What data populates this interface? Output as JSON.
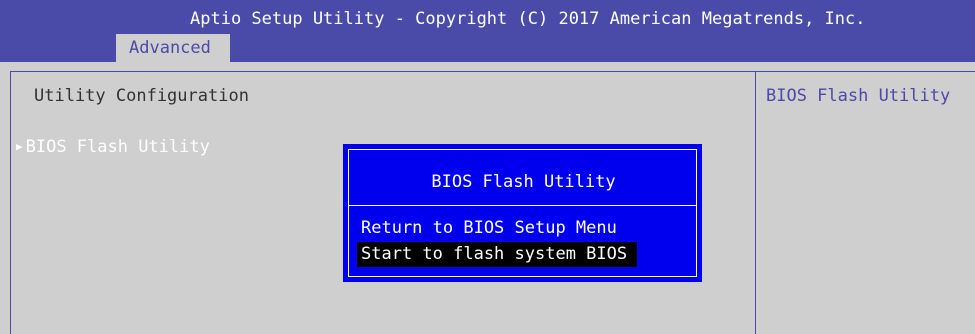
{
  "header": {
    "title": "Aptio Setup Utility - Copyright (C) 2017 American Megatrends, Inc.",
    "active_tab": "Advanced"
  },
  "main": {
    "section_title": "Utility Configuration",
    "menu_items": [
      {
        "label": "BIOS Flash Utility",
        "icon": "triangle-right-icon"
      }
    ],
    "help_text": "BIOS Flash Utility"
  },
  "dialog": {
    "title": "BIOS Flash Utility",
    "options": [
      {
        "label": "Return to BIOS Setup Menu",
        "selected": false
      },
      {
        "label": "Start to flash system BIOS",
        "selected": true
      }
    ]
  },
  "colors": {
    "header_bg": "#4a4aa8",
    "panel_bg": "#cfcfcf",
    "dialog_bg": "#0000ee",
    "highlight_bg": "#000000",
    "text_light": "#ffffff",
    "text_dark": "#333333",
    "accent": "#4a4aa8"
  }
}
